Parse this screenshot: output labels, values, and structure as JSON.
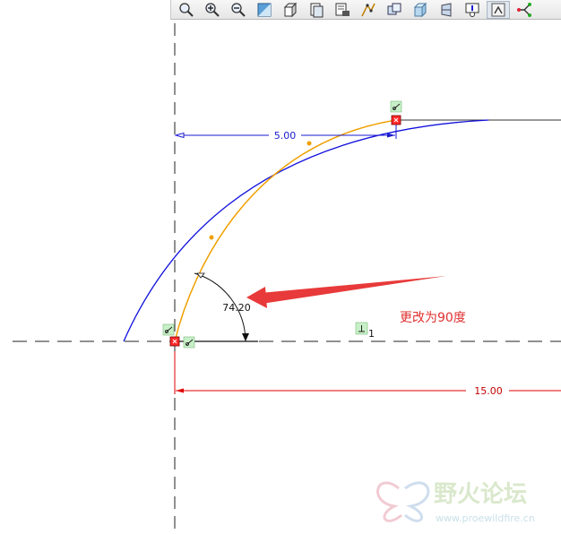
{
  "toolbar": {
    "buttons": [
      {
        "icon": "zoom-fit-icon"
      },
      {
        "icon": "zoom-in-icon"
      },
      {
        "icon": "zoom-out-icon"
      },
      {
        "icon": "repaint-icon"
      },
      {
        "icon": "view-orientation-icon"
      },
      {
        "icon": "saved-views-icon"
      },
      {
        "icon": "layer-icon"
      },
      {
        "icon": "datum-display-icon"
      },
      {
        "icon": "view-manager-icon"
      },
      {
        "icon": "display-style-icon"
      },
      {
        "icon": "perspective-icon"
      },
      {
        "icon": "annotation-display-icon"
      },
      {
        "icon": "sketch-display-icon"
      },
      {
        "icon": "constraint-display-icon"
      }
    ]
  },
  "sketch": {
    "dim_horizontal": "5.00",
    "dim_angle": "74.20",
    "dim_length": "15.00",
    "perpendicular_label": "1",
    "annotation_text": "更改为90度",
    "colors": {
      "arc": "#1010dd",
      "spline": "#f0a000",
      "dimension_blue": "#1a1ad0",
      "dimension_red": "#e00000",
      "annotation": "#e03030",
      "constraint_bg": "#c8f0c8"
    }
  },
  "watermark": {
    "title": "野火论坛",
    "url": "www.proewildfire.cn"
  }
}
